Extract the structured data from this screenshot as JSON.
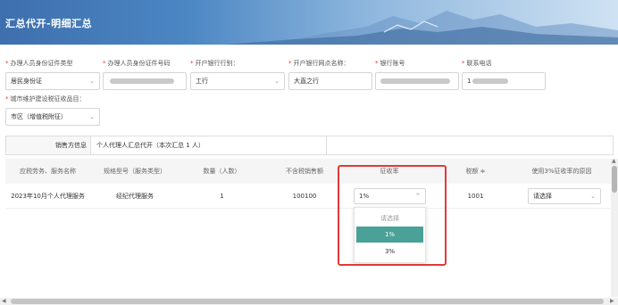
{
  "header": {
    "title": "汇总代开-明细汇总"
  },
  "form": {
    "id_type": {
      "label": "办理人员身份证件类型",
      "value": "居民身份证"
    },
    "id_number": {
      "label": "办理人员身份证件号码",
      "value": ""
    },
    "bank": {
      "label": "开户银行行别：",
      "value": "工行"
    },
    "bank_branch": {
      "label": "开户银行网点名称：",
      "value": "大直之行"
    },
    "account_no": {
      "label": "银行账号",
      "value": ""
    },
    "phone": {
      "label": "联系电话",
      "value": "1"
    },
    "city_tax": {
      "label": "城市维护建设税征收品目：",
      "value": "市区（增值税附征）"
    }
  },
  "info": {
    "label": "销售方信息",
    "value": "个人代理人汇总代开（本次汇总 1 人）"
  },
  "table": {
    "headers": [
      "应税劳务、服务名称",
      "规格型号（服务类型）",
      "数量（人数）",
      "不含税销售额",
      "征收率",
      "税额 ≑",
      "使用3%征收率的原因"
    ],
    "row": {
      "service_name": "2023年10月个人代理服务",
      "spec": "经纪代理服务",
      "quantity": "1",
      "sales_amount": "100100",
      "rate": "1%",
      "tax": "1001",
      "reason": "请选择"
    }
  },
  "rate_dropdown": {
    "placeholder": "请选择",
    "options": [
      "1%",
      "3%"
    ],
    "selected": "1%"
  },
  "colors": {
    "accent": "#4aa197",
    "highlight_border": "#e23a3a",
    "required": "#e33333"
  }
}
